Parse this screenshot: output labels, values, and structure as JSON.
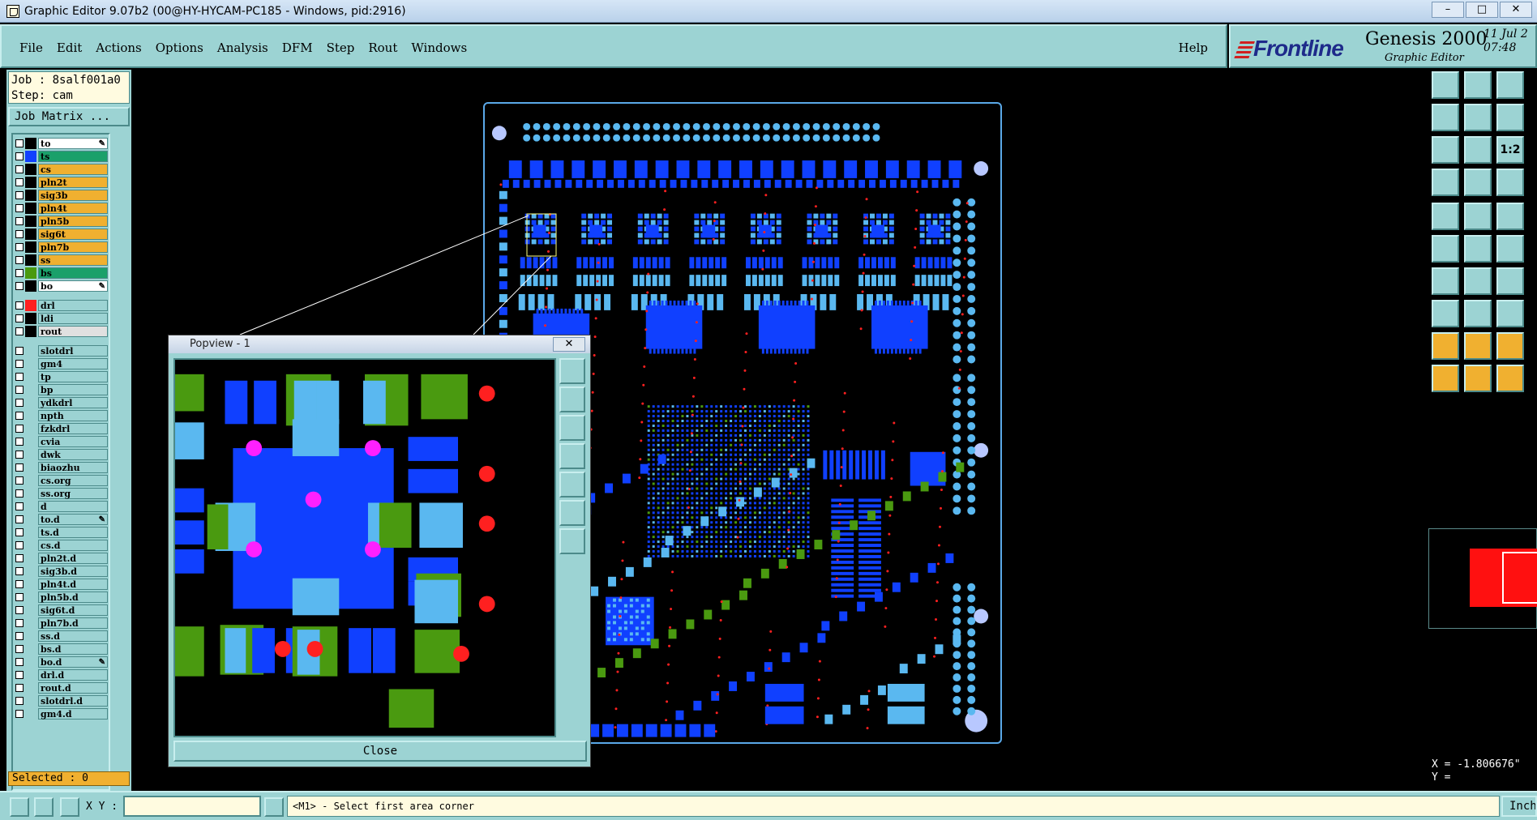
{
  "window": {
    "title": "Graphic Editor 9.07b2 (00@HY-HYCAM-PC185 - Windows, pid:2916)",
    "min": "–",
    "max": "□",
    "close": "✕"
  },
  "menu": {
    "items": [
      "File",
      "Edit",
      "Actions",
      "Options",
      "Analysis",
      "DFM",
      "Step",
      "Rout",
      "Windows"
    ],
    "help": "Help"
  },
  "brand": {
    "logo": "Frontline",
    "product": "Genesis 2000",
    "subtitle": "Graphic Editor",
    "date": "11 Jul 2",
    "time": "07:48"
  },
  "job": {
    "job": "Job : 8salf001a0",
    "step": "Step: cam",
    "matrix_button": "Job Matrix ..."
  },
  "layers": [
    {
      "name": "to",
      "color": "#ffffff",
      "swatch": "#000000",
      "pen": true
    },
    {
      "name": "ts",
      "color": "#1aa06a",
      "swatch": "#1040ff"
    },
    {
      "name": "cs",
      "color": "#f0b030",
      "swatch": "#000000"
    },
    {
      "name": "pln2t",
      "color": "#f0b030",
      "swatch": "#000000"
    },
    {
      "name": "sig3b",
      "color": "#f0b030",
      "swatch": "#000000"
    },
    {
      "name": "pln4t",
      "color": "#f0b030",
      "swatch": "#000000"
    },
    {
      "name": "pln5b",
      "color": "#f0b030",
      "swatch": "#000000"
    },
    {
      "name": "sig6t",
      "color": "#f0b030",
      "swatch": "#000000"
    },
    {
      "name": "pln7b",
      "color": "#f0b030",
      "swatch": "#000000"
    },
    {
      "name": "ss",
      "color": "#f0b030",
      "swatch": "#000000"
    },
    {
      "name": "bs",
      "color": "#1aa06a",
      "swatch": "#4a9a10"
    },
    {
      "name": "bo",
      "color": "#ffffff",
      "swatch": "#000000",
      "pen": true
    },
    {
      "name": "drl",
      "color": "#9cd3d3",
      "swatch": "#ff2020"
    },
    {
      "name": "ldi",
      "color": "#9cd3d3",
      "swatch": "#000000"
    },
    {
      "name": "rout",
      "color": "#e0e0e0",
      "swatch": "#000000"
    },
    {
      "name": "slotdrl",
      "color": "#9cd3d3"
    },
    {
      "name": "gm4",
      "color": "#9cd3d3"
    },
    {
      "name": "tp",
      "color": "#9cd3d3"
    },
    {
      "name": "bp",
      "color": "#9cd3d3"
    },
    {
      "name": "ydkdrl",
      "color": "#9cd3d3"
    },
    {
      "name": "npth",
      "color": "#9cd3d3"
    },
    {
      "name": "fzkdrl",
      "color": "#9cd3d3"
    },
    {
      "name": "cvia",
      "color": "#9cd3d3"
    },
    {
      "name": "dwk",
      "color": "#9cd3d3"
    },
    {
      "name": "biaozhu",
      "color": "#9cd3d3"
    },
    {
      "name": "cs.org",
      "color": "#9cd3d3"
    },
    {
      "name": "ss.org",
      "color": "#9cd3d3"
    },
    {
      "name": "d",
      "color": "#9cd3d3"
    },
    {
      "name": "to.d",
      "color": "#9cd3d3",
      "pen": true
    },
    {
      "name": "ts.d",
      "color": "#9cd3d3"
    },
    {
      "name": "cs.d",
      "color": "#9cd3d3"
    },
    {
      "name": "pln2t.d",
      "color": "#9cd3d3"
    },
    {
      "name": "sig3b.d",
      "color": "#9cd3d3"
    },
    {
      "name": "pln4t.d",
      "color": "#9cd3d3"
    },
    {
      "name": "pln5b.d",
      "color": "#9cd3d3"
    },
    {
      "name": "sig6t.d",
      "color": "#9cd3d3"
    },
    {
      "name": "pln7b.d",
      "color": "#9cd3d3"
    },
    {
      "name": "ss.d",
      "color": "#9cd3d3"
    },
    {
      "name": "bs.d",
      "color": "#9cd3d3"
    },
    {
      "name": "bo.d",
      "color": "#9cd3d3",
      "pen": true
    },
    {
      "name": "drl.d",
      "color": "#9cd3d3"
    },
    {
      "name": "rout.d",
      "color": "#9cd3d3"
    },
    {
      "name": "slotdrl.d",
      "color": "#9cd3d3"
    },
    {
      "name": "gm4.d",
      "color": "#9cd3d3"
    }
  ],
  "selected": "Selected : 0",
  "status": {
    "xy_label": "X Y :",
    "prompt": "<M1> - Select first area corner",
    "units": "Inch"
  },
  "coords": {
    "x": "X = -1.806676\"",
    "y": "Y ="
  },
  "popview": {
    "title": "Popview - 1",
    "close_x": "✕",
    "close_button": "Close"
  },
  "tools": {
    "ratio": "1:2"
  },
  "colors": {
    "panel": "#9cd3d3",
    "layer_active": "#f0b030",
    "pad_blue": "#1040ff",
    "pad_light": "#5ab8f0",
    "pad_green": "#4a9a10",
    "drill_red": "#ff2020",
    "via_magenta": "#ff20ff"
  }
}
